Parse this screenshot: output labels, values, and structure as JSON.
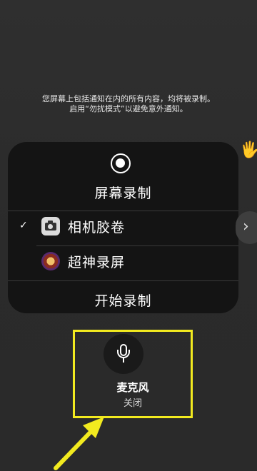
{
  "notice": {
    "line1": "您屏幕上包括通知在内的所有内容，均将被录制。",
    "line2": "启用“勿扰模式”以避免意外通知。"
  },
  "panel": {
    "title": "屏幕录制",
    "options": [
      {
        "label": "相机胶卷",
        "checked": true,
        "icon": "camera-icon"
      },
      {
        "label": "超神录屏",
        "checked": false,
        "icon": "app-icon"
      }
    ],
    "checkmark": "✓",
    "start_label": "开始录制"
  },
  "side_button": {
    "glyph": "›"
  },
  "microphone": {
    "label": "麦克风",
    "state": "关闭",
    "icon": "microphone-icon"
  },
  "colors": {
    "highlight": "#f2ea1f",
    "panel_bg": "#141414",
    "background": "#2d2d2d"
  }
}
